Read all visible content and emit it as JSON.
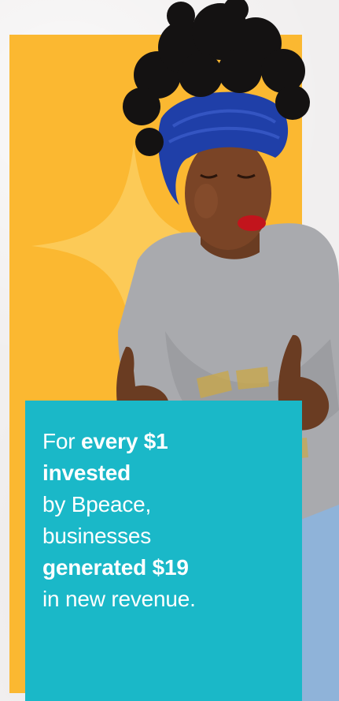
{
  "stat": {
    "line1_prefix": "For",
    "line1_bold": "every $1",
    "line2_bold": "invested",
    "line3": "by Bpeace,",
    "line4": "businesses",
    "line5_bold": "generated $19",
    "line6": "in new revenue."
  },
  "colors": {
    "panel": "#fbb831",
    "card": "#1ab8c8",
    "text": "#ffffff"
  }
}
